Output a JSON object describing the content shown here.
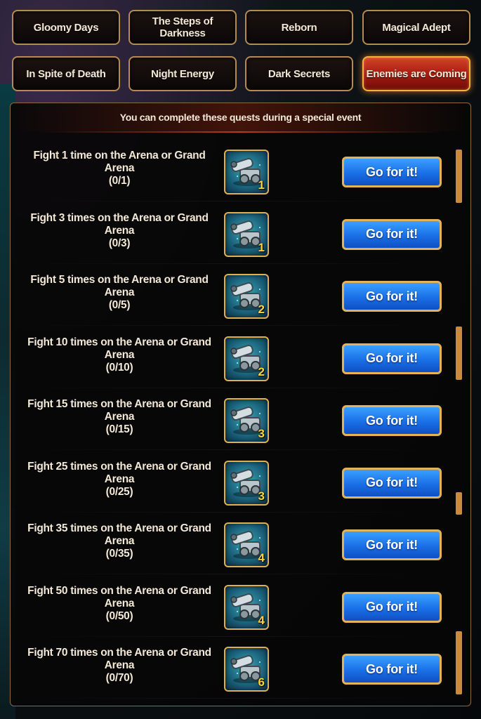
{
  "tabs": [
    {
      "label": "Gloomy Days",
      "active": false
    },
    {
      "label": "The Steps of Darkness",
      "active": false
    },
    {
      "label": "Reborn",
      "active": false
    },
    {
      "label": "Magical Adept",
      "active": false
    },
    {
      "label": "In Spite of Death",
      "active": false
    },
    {
      "label": "Night Energy",
      "active": false
    },
    {
      "label": "Dark Secrets",
      "active": false
    },
    {
      "label": "Enemies are Coming",
      "active": true
    }
  ],
  "panel": {
    "subtitle": "You can complete these quests during a special event"
  },
  "quests": [
    {
      "title": "Fight 1 time on the Arena or Grand Arena",
      "progress": "(0/1)",
      "reward_icon": "arena-cannon-icon",
      "reward_count": "1",
      "button": "Go for it!"
    },
    {
      "title": "Fight 3 times on the Arena or Grand Arena",
      "progress": "(0/3)",
      "reward_icon": "arena-cannon-icon",
      "reward_count": "1",
      "button": "Go for it!"
    },
    {
      "title": "Fight 5 times on the Arena or Grand Arena",
      "progress": "(0/5)",
      "reward_icon": "arena-cannon-icon",
      "reward_count": "2",
      "button": "Go for it!"
    },
    {
      "title": "Fight 10 times on the Arena or Grand Arena",
      "progress": "(0/10)",
      "reward_icon": "arena-cannon-icon",
      "reward_count": "2",
      "button": "Go for it!"
    },
    {
      "title": "Fight 15 times on the Arena or Grand Arena",
      "progress": "(0/15)",
      "reward_icon": "arena-cannon-icon",
      "reward_count": "3",
      "button": "Go for it!"
    },
    {
      "title": "Fight 25 times on the Arena or Grand Arena",
      "progress": "(0/25)",
      "reward_icon": "arena-cannon-icon",
      "reward_count": "3",
      "button": "Go for it!"
    },
    {
      "title": "Fight 35 times on the Arena or Grand Arena",
      "progress": "(0/35)",
      "reward_icon": "arena-cannon-icon",
      "reward_count": "4",
      "button": "Go for it!"
    },
    {
      "title": "Fight 50 times on the Arena or Grand Arena",
      "progress": "(0/50)",
      "reward_icon": "arena-cannon-icon",
      "reward_count": "4",
      "button": "Go for it!"
    },
    {
      "title": "Fight 70 times on the Arena or Grand Arena",
      "progress": "(0/70)",
      "reward_icon": "arena-cannon-icon",
      "reward_count": "6",
      "button": "Go for it!"
    }
  ],
  "colors": {
    "accent_gold": "#e3b35a",
    "active_tab_red": "#c2301c",
    "button_blue": "#1a6fe6",
    "reward_count_yellow": "#ffd43a"
  }
}
